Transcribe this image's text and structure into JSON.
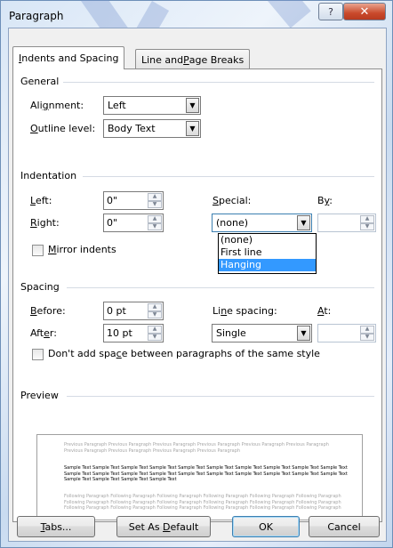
{
  "window": {
    "title": "Paragraph",
    "help_symbol": "?",
    "close_symbol": "✕"
  },
  "tabs": [
    {
      "pre": "",
      "ul": "I",
      "post": "ndents and Spacing"
    },
    {
      "pre": "Line and ",
      "ul": "P",
      "post": "age Breaks"
    }
  ],
  "general": {
    "label": "General",
    "alignment": {
      "pre": "Ali",
      "ul": "g",
      "post": "nment:",
      "value": "Left"
    },
    "outline": {
      "pre": "",
      "ul": "O",
      "post": "utline level:",
      "value": "Body Text"
    }
  },
  "indentation": {
    "label": "Indentation",
    "left": {
      "pre": "",
      "ul": "L",
      "post": "eft:",
      "value": "0\""
    },
    "right": {
      "pre": "",
      "ul": "R",
      "post": "ight:",
      "value": "0\""
    },
    "special": {
      "pre": "",
      "ul": "S",
      "post": "pecial:",
      "value": "(none)"
    },
    "by": {
      "pre": "B",
      "ul": "y",
      "post": ":"
    },
    "mirror": {
      "pre": "",
      "ul": "M",
      "post": "irror indents"
    },
    "special_options": [
      "(none)",
      "First line",
      "Hanging"
    ]
  },
  "spacing": {
    "label": "Spacing",
    "before": {
      "pre": "",
      "ul": "B",
      "post": "efore:",
      "value": "0 pt"
    },
    "after": {
      "pre": "Aft",
      "ul": "e",
      "post": "r:",
      "value": "10 pt"
    },
    "line_spacing": {
      "pre": "Li",
      "ul": "n",
      "post": "e spacing:",
      "value": "Single"
    },
    "at": {
      "pre": "",
      "ul": "A",
      "post": "t:"
    },
    "dont_add": {
      "pre": "Don't add spa",
      "ul": "c",
      "post": "e between paragraphs of the same style"
    }
  },
  "preview": {
    "label": "Preview",
    "previous_text": "Previous Paragraph Previous Paragraph Previous Paragraph Previous Paragraph Previous Paragraph Previous Paragraph Previous Paragraph Previous Paragraph Previous Paragraph Previous Paragraph",
    "sample_text": "Sample Text Sample Text Sample Text Sample Text Sample Text Sample Text Sample Text Sample Text Sample Text Sample Text Sample Text Sample Text Sample Text Sample Text Sample Text Sample Text Sample Text Sample Text Sample Text Sample Text Sample Text Sample Text Sample Text Sample Text",
    "following_text": "Following Paragraph Following Paragraph Following Paragraph Following Paragraph Following Paragraph Following Paragraph Following Paragraph Following Paragraph Following Paragraph Following Paragraph Following Paragraph Following Paragraph Following Paragraph Following Paragraph Following Paragraph Following Paragraph Following Paragraph Following Paragraph"
  },
  "buttons": {
    "tabs": {
      "pre": "",
      "ul": "T",
      "post": "abs..."
    },
    "set_default": {
      "pre": "Set As ",
      "ul": "D",
      "post": "efault"
    },
    "ok": "OK",
    "cancel": "Cancel"
  },
  "colors": {
    "selection": "#3399ff",
    "close_button": "#c94a2c",
    "title_gradient": "#d8e6f6"
  },
  "icons": {
    "help": "question-mark-icon",
    "close": "close-x-icon",
    "dropdown": "chevron-down-icon",
    "spin": "spin-arrows-icon"
  }
}
